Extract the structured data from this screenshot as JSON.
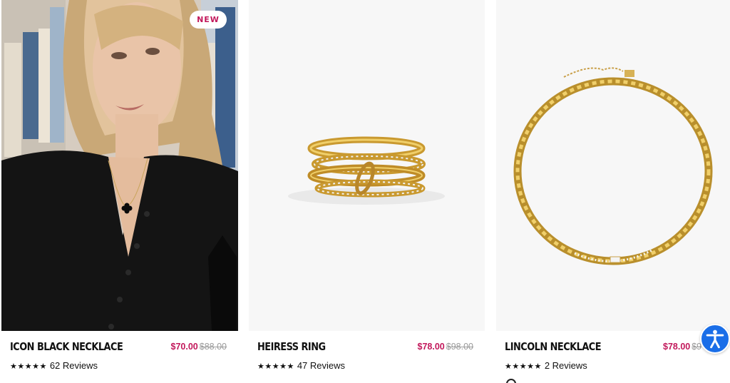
{
  "products": [
    {
      "name": "Icon Black Necklace",
      "sale_price": "$70.00",
      "original_price": "$88.00",
      "badge": "NEW",
      "stars": "★★★★★",
      "reviews": "62 Reviews",
      "image": "model-wearing-necklace-photo"
    },
    {
      "name": "Heiress Ring",
      "sale_price": "$78.00",
      "original_price": "$98.00",
      "stars": "★★★★★",
      "reviews": "47 Reviews",
      "image": "gold-stacked-ring-photo"
    },
    {
      "name": "Lincoln Necklace",
      "sale_price": "$78.00",
      "original_price": "$9",
      "stars": "★★★★★",
      "reviews": "2 Reviews",
      "image": "gold-chain-necklace-photo"
    }
  ],
  "colors": {
    "sale": "#c2185b",
    "original": "#9a9a9a",
    "accessibility_button": "#1a6ee8"
  },
  "accessibility_button": {
    "icon": "accessibility-icon"
  }
}
